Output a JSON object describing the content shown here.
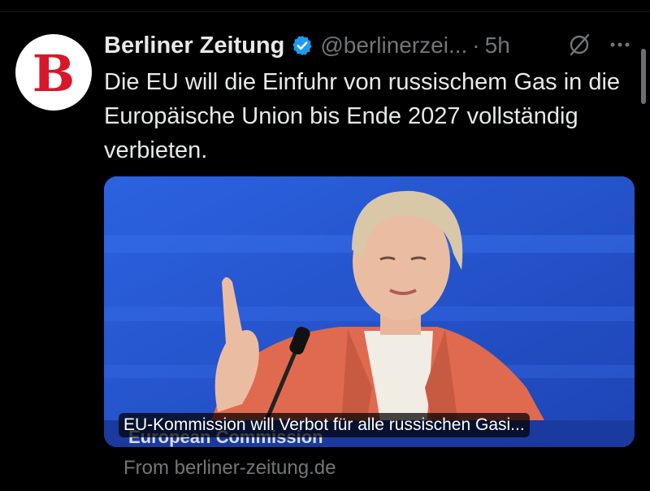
{
  "tweet": {
    "author": "Berliner Zeitung",
    "handle": "@berlinerzei...",
    "separator": "·",
    "time": "5h",
    "text": "Die EU will die Einfuhr von russischem Gas in die Europäische Union bis Ende 2027 vollständig verbieten.",
    "avatar_letter": "B",
    "verified_color": "#1d9bf0"
  },
  "card": {
    "title": "EU-Kommission will Verbot für alle russischen Gasi...",
    "podium_text": "European Commission",
    "source": "From berliner-zeitung.de"
  },
  "icons": [
    "verified-badge-icon",
    "grok-icon",
    "more-icon"
  ]
}
